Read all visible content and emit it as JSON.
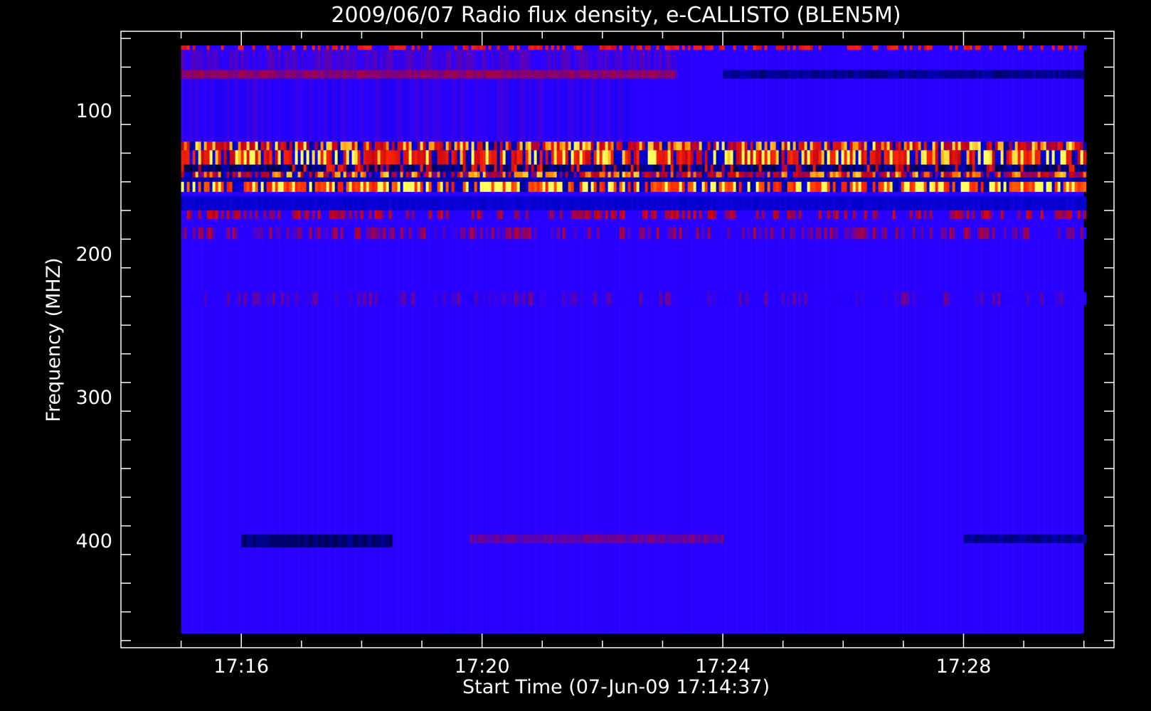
{
  "chart_data": {
    "type": "heatmap",
    "title": "2009/06/07  Radio flux density, e-CALLISTO (BLEN5M)",
    "xlabel": "Start Time (07-Jun-09 17:14:37)",
    "ylabel": "Frequency (MHZ)",
    "x_tick_labels": [
      "17:16",
      "17:20",
      "17:24",
      "17:28"
    ],
    "x_ticks_minutes": [
      16,
      20,
      24,
      28
    ],
    "x_range_minutes": [
      14.0,
      30.5
    ],
    "data_range_minutes": [
      15.0,
      30.0
    ],
    "y_tick_labels": [
      "100",
      "200",
      "300",
      "400"
    ],
    "y_ticks": [
      100,
      200,
      300,
      400
    ],
    "y_range": [
      45,
      475
    ],
    "y_inverted": true,
    "data_freq_range": [
      55,
      465
    ],
    "colormap": [
      "#000000",
      "#0000c8",
      "#2a00ff",
      "#c0001a",
      "#ff2a00",
      "#ff8c00",
      "#ffff60"
    ],
    "background_color": "#2a00ff",
    "bands": [
      {
        "freq": [
          55,
          58
        ],
        "level": 0.55,
        "pattern": "speckle"
      },
      {
        "freq": [
          58,
          72
        ],
        "level": 0.36,
        "end_minutes": 23.2
      },
      {
        "freq": [
          72,
          78
        ],
        "level": 0.44,
        "end_minutes": 23.2
      },
      {
        "freq": [
          72,
          78
        ],
        "level": 0.12,
        "start_minutes": 24.0
      },
      {
        "freq": [
          78,
          122
        ],
        "level": 0.33,
        "end_minutes": 22.5
      },
      {
        "freq": [
          122,
          128
        ],
        "level": 0.55,
        "pattern": "bursts"
      },
      {
        "freq": [
          128,
          138
        ],
        "level": 0.62,
        "pattern": "bursts"
      },
      {
        "freq": [
          138,
          143
        ],
        "level": 0.05,
        "pattern": "dark"
      },
      {
        "freq": [
          143,
          147
        ],
        "level": 0.5,
        "pattern": "bursts"
      },
      {
        "freq": [
          147,
          150
        ],
        "level": 0.15
      },
      {
        "freq": [
          150,
          157
        ],
        "level": 0.72,
        "pattern": "bursts"
      },
      {
        "freq": [
          160,
          170
        ],
        "level": 0.2
      },
      {
        "freq": [
          170,
          176
        ],
        "level": 0.42,
        "pattern": "speckle"
      },
      {
        "freq": [
          182,
          190
        ],
        "level": 0.36,
        "pattern": "speckle"
      },
      {
        "freq": [
          227,
          236
        ],
        "level": 0.3,
        "pattern": "speckle"
      },
      {
        "freq": [
          396,
          402
        ],
        "level": 0.4,
        "start_minutes": 19.8,
        "end_minutes": 24.0
      },
      {
        "freq": [
          396,
          405
        ],
        "level": 0.1,
        "start_minutes": 16.0,
        "end_minutes": 18.5
      },
      {
        "freq": [
          396,
          402
        ],
        "level": 0.12,
        "start_minutes": 28.0,
        "end_minutes": 30.0
      }
    ]
  }
}
